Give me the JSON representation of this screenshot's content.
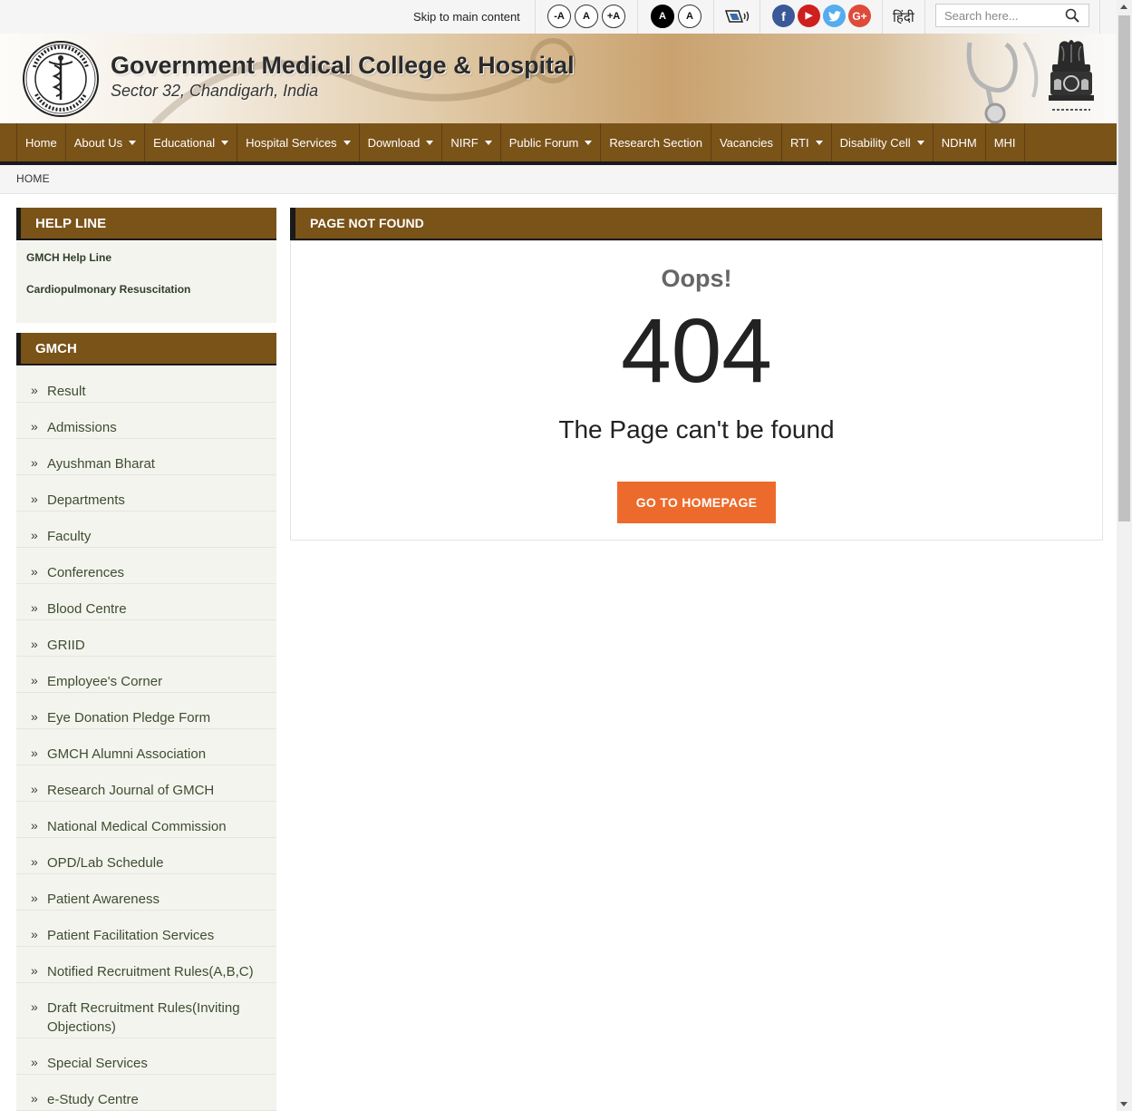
{
  "topbar": {
    "skip_link": "Skip to main content",
    "font_sizes": [
      "-A",
      "A",
      "+A"
    ],
    "contrast": [
      "A",
      "A"
    ],
    "screen_reader_icon": "screen-reader-icon",
    "social": [
      {
        "name": "facebook-icon",
        "glyph": "f",
        "color": "#3b5998"
      },
      {
        "name": "youtube-icon",
        "glyph": "▶",
        "color": "#cd201f"
      },
      {
        "name": "twitter-icon",
        "glyph": "t",
        "color": "#55acee"
      },
      {
        "name": "google-plus-icon",
        "glyph": "G+",
        "color": "#dd4b39"
      }
    ],
    "language": "हिंदी",
    "search_placeholder": "Search here..."
  },
  "header": {
    "title": "Government Medical College & Hospital",
    "subtitle": "Sector 32, Chandigarh, India"
  },
  "nav": {
    "items": [
      {
        "label": "Home",
        "dropdown": false
      },
      {
        "label": "About Us",
        "dropdown": true
      },
      {
        "label": "Educational",
        "dropdown": true
      },
      {
        "label": "Hospital Services",
        "dropdown": true
      },
      {
        "label": "Download",
        "dropdown": true
      },
      {
        "label": "NIRF",
        "dropdown": true
      },
      {
        "label": "Public Forum",
        "dropdown": true
      },
      {
        "label": "Research Section",
        "dropdown": false
      },
      {
        "label": "Vacancies",
        "dropdown": false
      },
      {
        "label": "RTI",
        "dropdown": true
      },
      {
        "label": "Disability Cell",
        "dropdown": true
      },
      {
        "label": "NDHM",
        "dropdown": false
      },
      {
        "label": "MHI",
        "dropdown": false
      }
    ]
  },
  "breadcrumb": {
    "home": "HOME"
  },
  "sidebar": {
    "helpline": {
      "title": "HELP LINE",
      "links": [
        "GMCH Help Line",
        "Cardiopulmonary Resuscitation"
      ]
    },
    "gmch": {
      "title": "GMCH",
      "links": [
        "Result",
        "Admissions",
        "Ayushman Bharat",
        "Departments",
        "Faculty",
        "Conferences",
        "Blood Centre",
        "GRIID",
        "Employee's Corner",
        "Eye Donation Pledge Form",
        "GMCH Alumni Association",
        "Research Journal of GMCH",
        "National Medical Commission",
        "OPD/Lab Schedule",
        "Patient Awareness",
        "Patient Facilitation Services",
        "Notified Recruitment Rules(A,B,C)",
        "Draft Recruitment Rules(Inviting Objections)",
        "Special Services",
        "e-Study Centre"
      ]
    }
  },
  "main": {
    "title": "PAGE NOT FOUND",
    "oops": "Oops!",
    "code": "404",
    "message": "The Page can't be found",
    "button": "GO TO HOMEPAGE"
  }
}
